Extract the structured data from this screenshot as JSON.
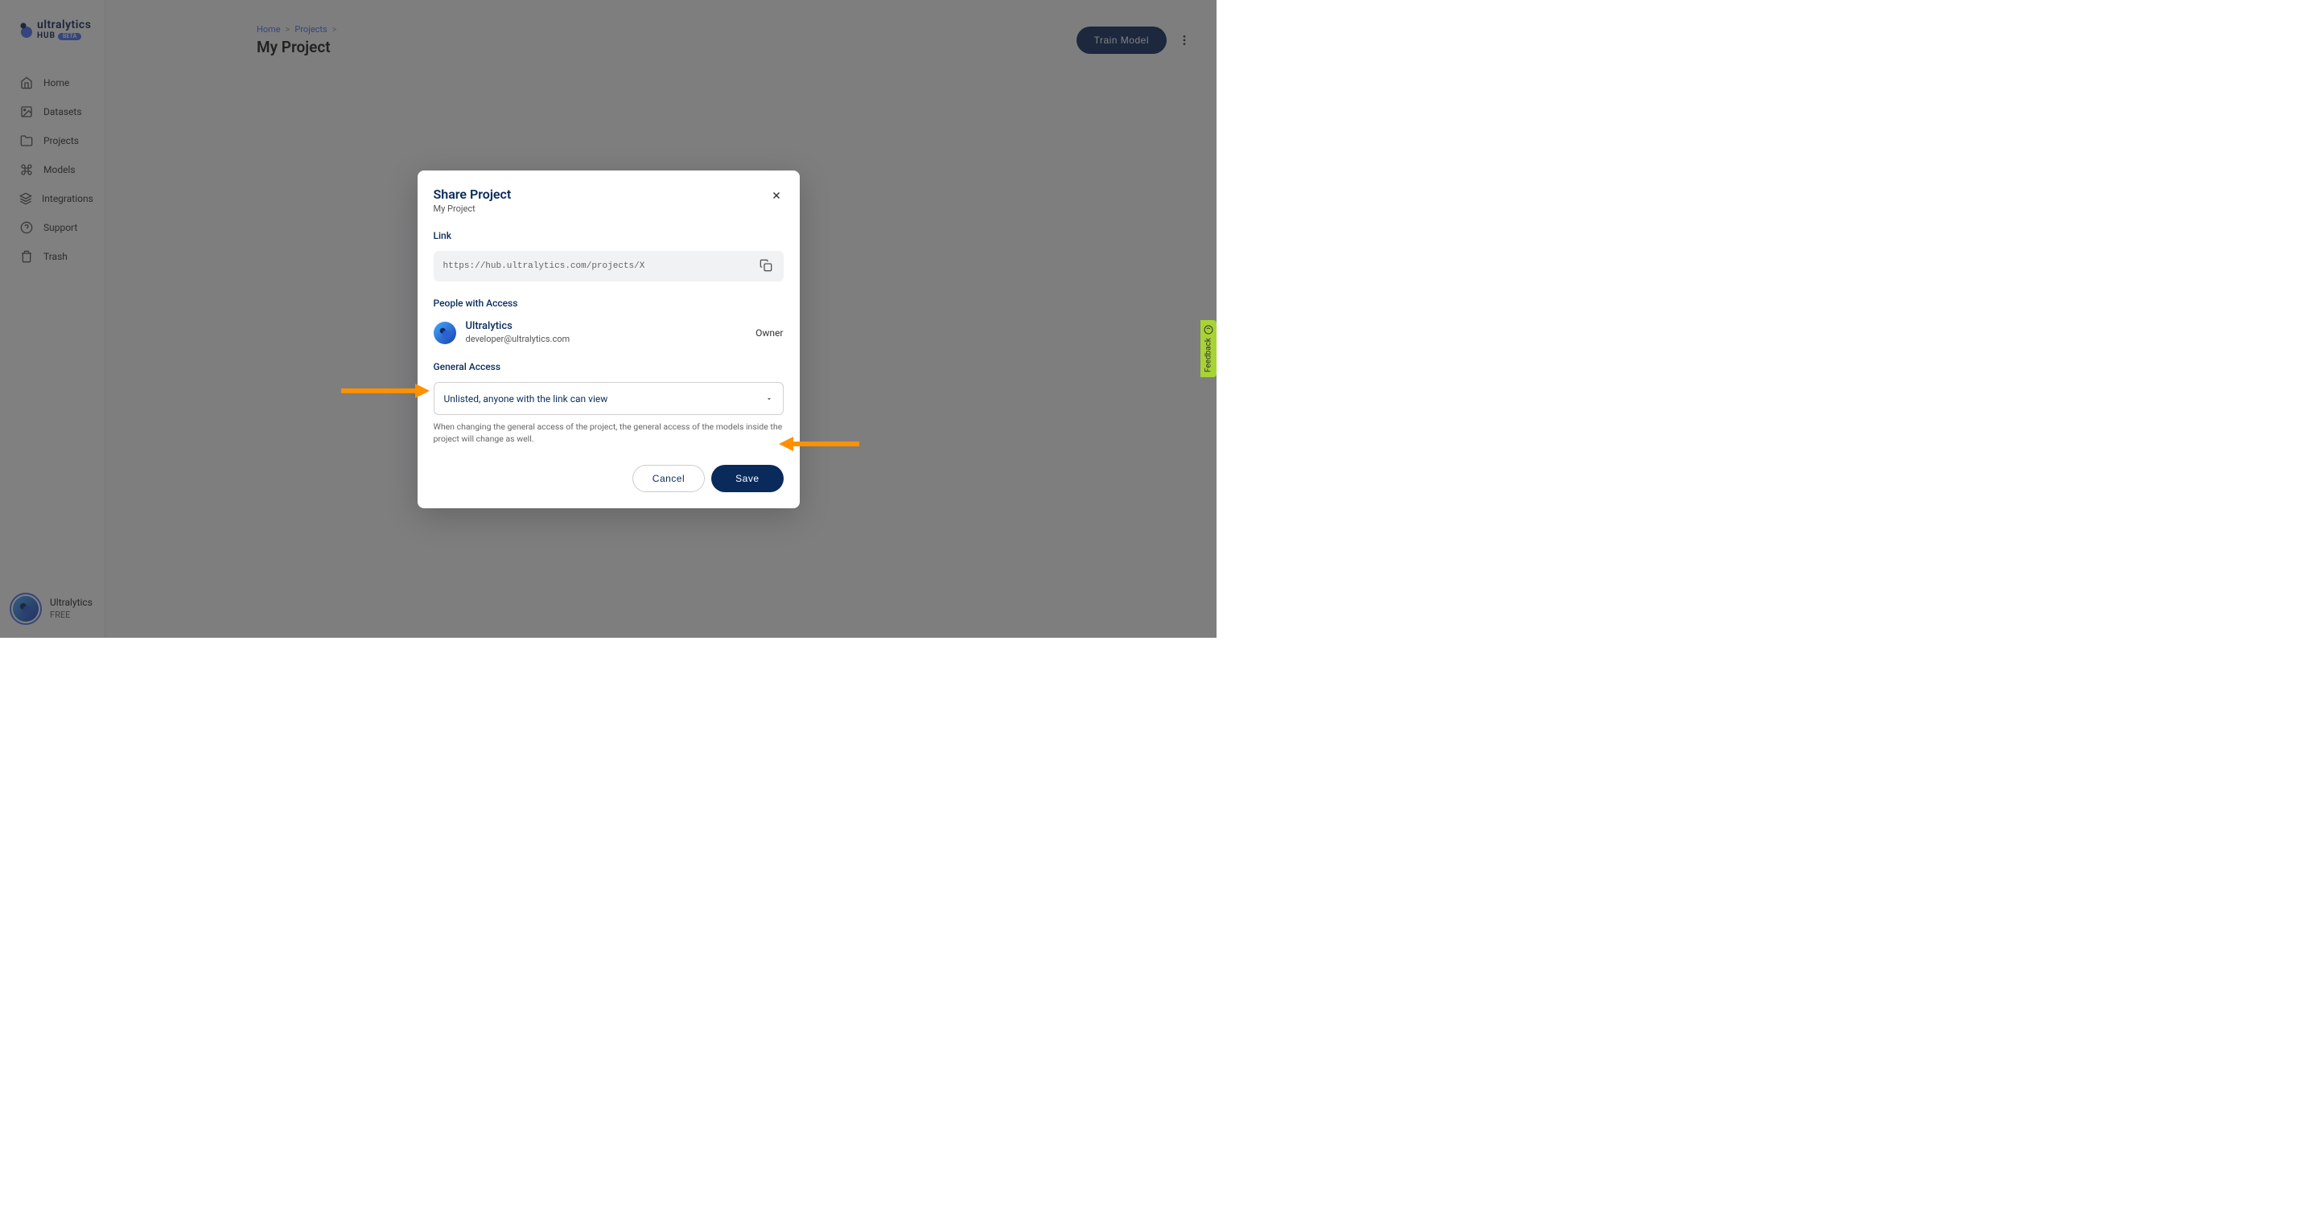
{
  "brand": {
    "name": "ultralytics",
    "hub_label": "HUB",
    "beta_label": "BETA"
  },
  "sidebar": {
    "items": [
      {
        "label": "Home"
      },
      {
        "label": "Datasets"
      },
      {
        "label": "Projects"
      },
      {
        "label": "Models"
      },
      {
        "label": "Integrations"
      },
      {
        "label": "Support"
      },
      {
        "label": "Trash"
      }
    ]
  },
  "user": {
    "name": "Ultralytics",
    "tier": "FREE"
  },
  "breadcrumbs": {
    "items": [
      "Home",
      "Projects"
    ],
    "sep": ">"
  },
  "page": {
    "title": "My Project",
    "train_button": "Train Model"
  },
  "modal": {
    "title": "Share Project",
    "subtitle": "My Project",
    "link_label": "Link",
    "link_url": "https://hub.ultralytics.com/projects/X",
    "people_label": "People with Access",
    "people": {
      "name": "Ultralytics",
      "email": "developer@ultralytics.com",
      "role": "Owner"
    },
    "access_label": "General Access",
    "access_selected": "Unlisted, anyone with the link can view",
    "access_hint": "When changing the general access of the project, the general access of the models inside the project will change as well.",
    "cancel_label": "Cancel",
    "save_label": "Save"
  },
  "feedback": {
    "label": "Feedback"
  }
}
